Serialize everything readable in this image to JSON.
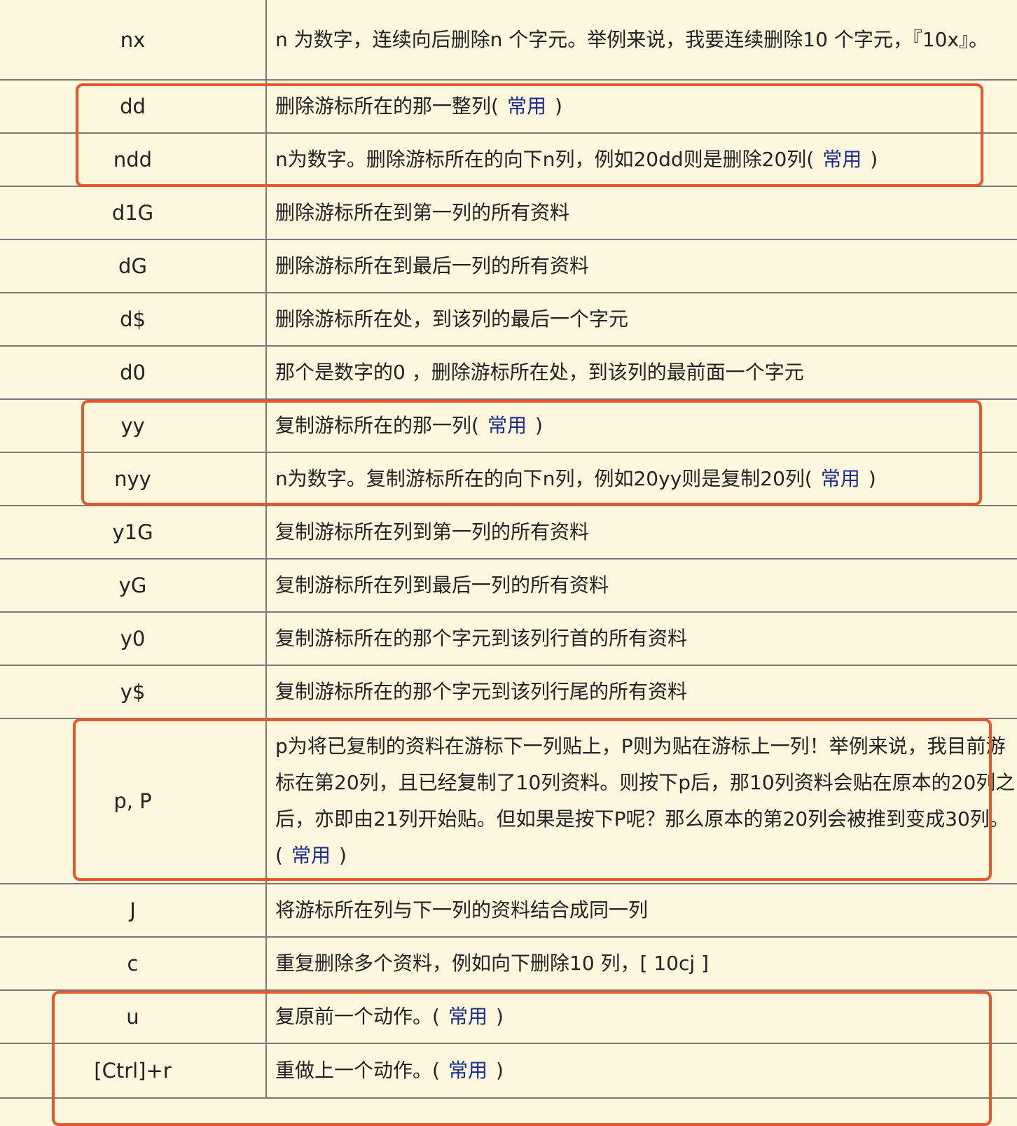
{
  "table": {
    "rows": [
      {
        "key": "nx",
        "text": "n 为数字，连续向后删除n 个字元。举例来说，我要连续删除10 个字元，『10x』。",
        "tag": "",
        "after": ""
      },
      {
        "key": "dd",
        "text": "删除游标所在的那一整列(",
        "tag": "常用",
        "after": ")"
      },
      {
        "key": "ndd",
        "text": "n为数字。删除游标所在的向下n列，例如20dd则是删除20列(",
        "tag": "常用",
        "after": ")"
      },
      {
        "key": "d1G",
        "text": "删除游标所在到第一列的所有资料",
        "tag": "",
        "after": ""
      },
      {
        "key": "dG",
        "text": "删除游标所在到最后一列的所有资料",
        "tag": "",
        "after": ""
      },
      {
        "key": "d$",
        "text": "删除游标所在处，到该列的最后一个字元",
        "tag": "",
        "after": ""
      },
      {
        "key": "d0",
        "text": "那个是数字的0 ，删除游标所在处，到该列的最前面一个字元",
        "tag": "",
        "after": ""
      },
      {
        "key": "yy",
        "text": "复制游标所在的那一列(",
        "tag": "常用",
        "after": ")"
      },
      {
        "key": "nyy",
        "text": "n为数字。复制游标所在的向下n列，例如20yy则是复制20列(",
        "tag": "常用",
        "after": ")"
      },
      {
        "key": "y1G",
        "text": "复制游标所在列到第一列的所有资料",
        "tag": "",
        "after": ""
      },
      {
        "key": "yG",
        "text": "复制游标所在列到最后一列的所有资料",
        "tag": "",
        "after": ""
      },
      {
        "key": "y0",
        "text": "复制游标所在的那个字元到该列行首的所有资料",
        "tag": "",
        "after": ""
      },
      {
        "key": "y$",
        "text": "复制游标所在的那个字元到该列行尾的所有资料",
        "tag": "",
        "after": ""
      },
      {
        "key": "p, P",
        "text": "p为将已复制的资料在游标下一列贴上，P则为贴在游标上一列！举例来说，我目前游标在第20列，且已经复制了10列资料。则按下p后，那10列资料会贴在原本的20列之后，亦即由21列开始贴。但如果是按下P呢？那么原本的第20列会被推到变成30列。(",
        "tag": "常用",
        "after": ")"
      },
      {
        "key": "J",
        "text": "将游标所在列与下一列的资料结合成同一列",
        "tag": "",
        "after": ""
      },
      {
        "key": "c",
        "text": "重复删除多个资料，例如向下删除10 列，[ 10cj ]",
        "tag": "",
        "after": ""
      },
      {
        "key": "u",
        "text": "复原前一个动作。(",
        "tag": "常用",
        "after": ")"
      },
      {
        "key": "[Ctrl]+r",
        "text": "重做上一个动作。(",
        "tag": "常用",
        "after": ")"
      }
    ]
  },
  "colors": {
    "background": "#fdf8dd",
    "grid": "#7a7a7a",
    "tag": "#1c2c8a",
    "highlight": "#e8572c"
  }
}
